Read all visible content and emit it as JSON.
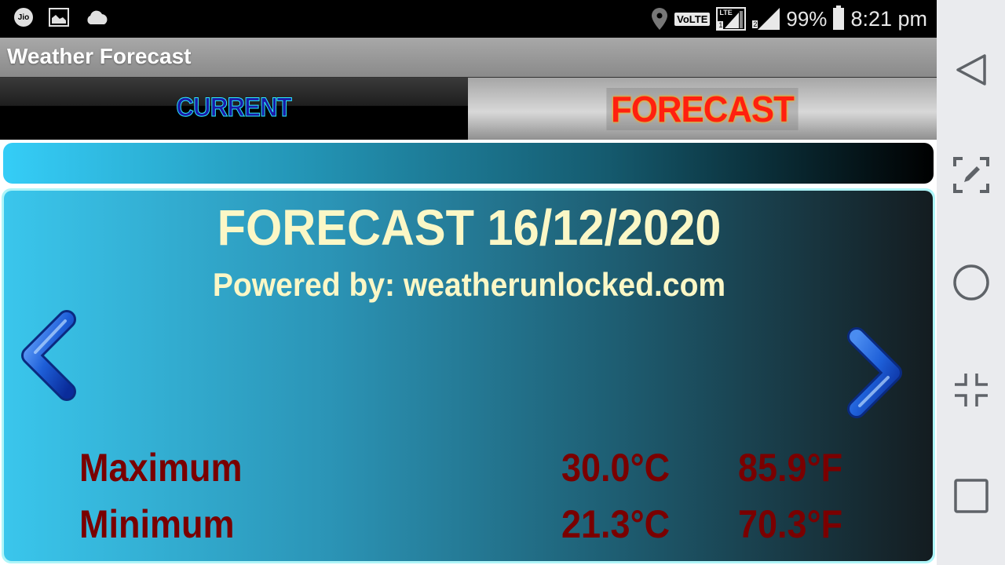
{
  "status_bar": {
    "left_icons": [
      "jio-icon",
      "gallery-icon",
      "cloud-icon"
    ],
    "jio_label": "Jio",
    "volte_label": "VoLTE",
    "lte_label": "LTE",
    "sim1_label": "1",
    "sim2_label": "2",
    "battery_percent": "99%",
    "time": "8:21 pm"
  },
  "app": {
    "title": "Weather Forecast"
  },
  "tabs": [
    {
      "label": "CURRENT",
      "active": false
    },
    {
      "label": "FORECAST",
      "active": true
    }
  ],
  "forecast": {
    "title": "FORECAST 16/12/2020",
    "powered_by": "Powered by: weatherunlocked.com",
    "rows": [
      {
        "label": "Maximum",
        "celsius": "30.0°C",
        "fahrenheit": "85.9°F"
      },
      {
        "label": "Minimum",
        "celsius": "21.3°C",
        "fahrenheit": "70.3°F"
      }
    ],
    "prev_icon": "chevron-left-icon",
    "next_icon": "chevron-right-icon"
  },
  "colors": {
    "heading_text": "#fbf7c6",
    "temperature_text": "#7a0000",
    "forecast_tab_text": "#ff2010",
    "current_tab_text": "#1a1aa8"
  },
  "nav_bar": [
    "back-icon",
    "screenshot-edit-icon",
    "home-icon",
    "exit-fullscreen-icon",
    "recents-icon"
  ]
}
